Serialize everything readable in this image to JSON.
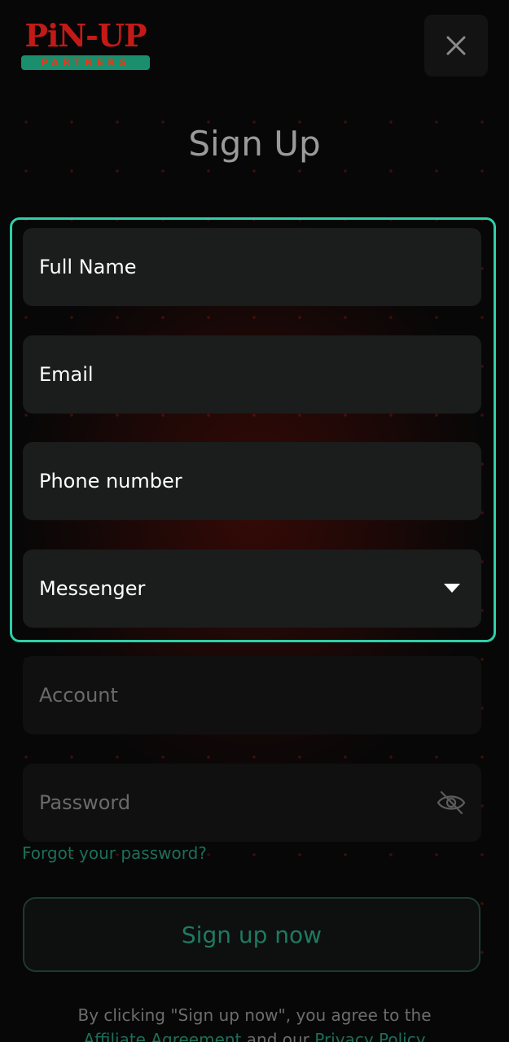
{
  "brand": {
    "logo_word": "PiN-UP",
    "logo_sub": "PARTNERS"
  },
  "header": {
    "title": "Sign Up"
  },
  "form": {
    "full_name": "Full Name",
    "email": "Email",
    "phone": "Phone number",
    "messenger": "Messenger",
    "account": "Account",
    "password": "Password",
    "forgot": "Forgot your password?",
    "submit": "Sign up now"
  },
  "terms": {
    "prefix": "By clicking \"Sign up now\", you agree to the",
    "agreement_link": "Affiliate Agreement",
    "middle": "and our",
    "privacy_link": "Privacy Policy"
  },
  "icons": {
    "close": "close-icon",
    "dropdown": "chevron-down-icon",
    "password_toggle": "eye-slash-icon"
  },
  "colors": {
    "accent": "#2fcfa8",
    "brand_red": "#c41a17",
    "brand_green": "#1a8f6e",
    "link": "#1c6e58"
  }
}
